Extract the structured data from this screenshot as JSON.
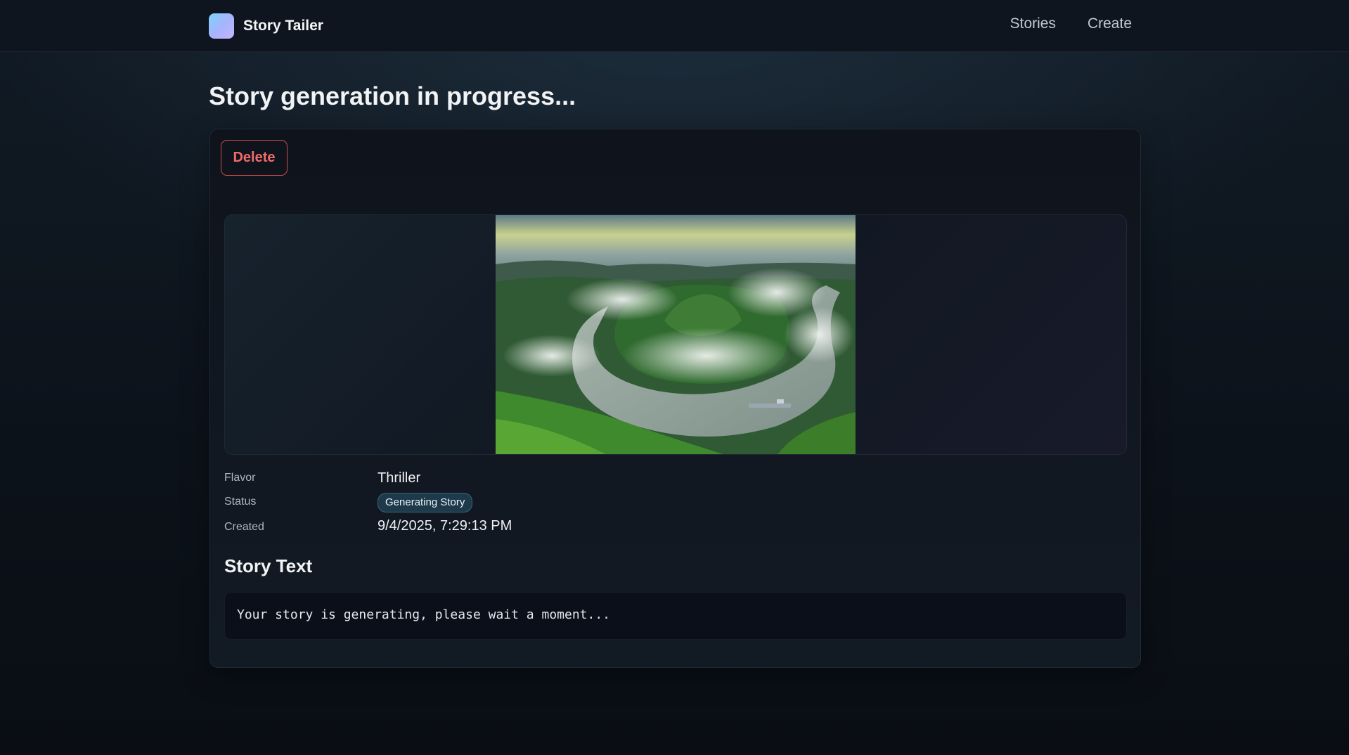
{
  "header": {
    "brand": "Story Tailer",
    "nav": [
      "Stories",
      "Create"
    ]
  },
  "page": {
    "title": "Story generation in progress..."
  },
  "card": {
    "delete_label": "Delete",
    "meta": {
      "flavor_label": "Flavor",
      "flavor_value": "Thriller",
      "status_label": "Status",
      "status_value": "Generating Story",
      "created_label": "Created",
      "created_value": "9/4/2025, 7:29:13 PM"
    },
    "story_section_title": "Story Text",
    "story_text": "Your story is generating, please wait a moment..."
  },
  "colors": {
    "accent_danger": "#f26b6b",
    "badge_bg": "#1e3a4a",
    "logo_gradient": [
      "#7dd3fc",
      "#c4b5fd"
    ]
  },
  "icons": {
    "brand_logo": "story-tailer-logo-icon"
  }
}
